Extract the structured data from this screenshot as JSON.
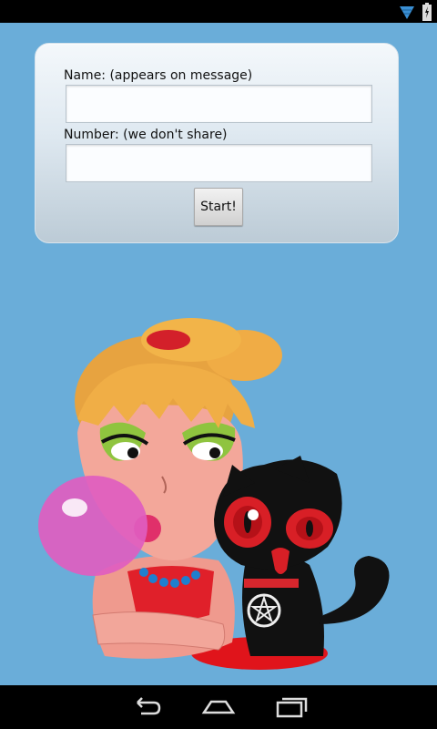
{
  "form": {
    "name_label": "Name: (appears on message)",
    "name_value": "",
    "number_label": "Number: (we don't share)",
    "number_value": "",
    "start_label": "Start!"
  },
  "status_bar": {
    "icons": [
      "wifi-icon",
      "battery-charging-icon"
    ]
  },
  "nav_bar": {
    "icons": [
      "back-icon",
      "home-icon",
      "recent-apps-icon"
    ]
  },
  "colors": {
    "background": "#6aadd9",
    "bars": "#000000",
    "card_top": "#f4f8fb",
    "card_bottom": "#bccbd6"
  }
}
